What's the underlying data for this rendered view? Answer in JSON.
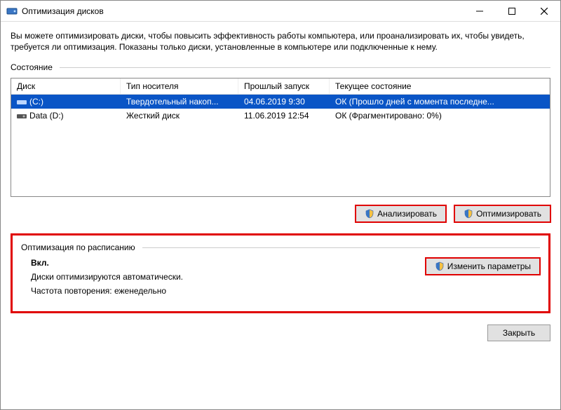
{
  "window": {
    "title": "Оптимизация дисков"
  },
  "description": "Вы можете оптимизировать диски, чтобы повысить эффективность работы компьютера, или проанализировать их, чтобы увидеть, требуется ли оптимизация. Показаны только диски, установленные в компьютере или подключенные к нему.",
  "status_label": "Состояние",
  "columns": {
    "disk": "Диск",
    "media": "Тип носителя",
    "lastrun": "Прошлый запуск",
    "current": "Текущее состояние"
  },
  "rows": [
    {
      "name": "(C:)",
      "media": "Твердотельный накоп...",
      "lastrun": "04.06.2019 9:30",
      "status": "ОК (Прошло дней с момента последне...",
      "selected": true,
      "icon": "ssd"
    },
    {
      "name": "Data (D:)",
      "media": "Жесткий диск",
      "lastrun": "11.06.2019 12:54",
      "status": "ОК (Фрагментировано: 0%)",
      "selected": false,
      "icon": "hdd"
    }
  ],
  "buttons": {
    "analyze": "Анализировать",
    "optimize": "Оптимизировать",
    "change": "Изменить параметры",
    "close": "Закрыть"
  },
  "schedule": {
    "heading": "Оптимизация по расписанию",
    "state": "Вкл.",
    "line1": "Диски оптимизируются автоматически.",
    "line2": "Частота повторения: еженедельно"
  }
}
